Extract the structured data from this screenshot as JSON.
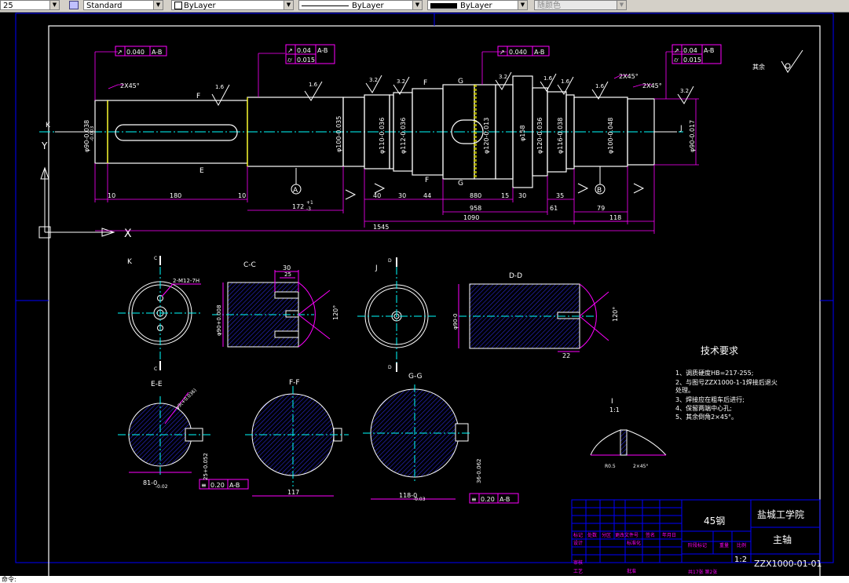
{
  "toolbar": {
    "scale_value": "25",
    "dimstyle_value": "Standard",
    "layer_value": "ByLayer",
    "linetype_value": "ByLayer",
    "lineweight_value": "ByLayer",
    "plotstyle_value": "随颜色"
  },
  "colors": {
    "background": "#000000",
    "border": "#0000ff",
    "dimension": "#ff00ff",
    "geometry": "#ffffff",
    "centerline": "#00ffff",
    "hatch": "#2020c0",
    "text": "#ffffff",
    "yellow": "#ffff00"
  },
  "drawing": {
    "view_labels": {
      "k": "K",
      "j": "J",
      "cc": "C-C",
      "dd": "D-D",
      "ee": "E-E",
      "ff": "F-F",
      "gg": "G-G",
      "detail": "I",
      "detail_scale": "1:1",
      "section_f": "F",
      "section_g": "G",
      "section_e": "E",
      "datum_a": "A",
      "datum_b": "B",
      "c_mark": "C",
      "d_mark": "D"
    },
    "tolerance_frames": [
      {
        "sym": "↗",
        "value": "0.040",
        "datum": "A-B"
      },
      {
        "sym": "↗",
        "value": "0.04",
        "datum": "A-B"
      },
      {
        "sym": "⌭",
        "value": "0.015",
        "datum": ""
      },
      {
        "sym": "↗",
        "value": "0.040",
        "datum": "A-B"
      },
      {
        "sym": "↗",
        "value": "0.04",
        "datum": "A-B"
      },
      {
        "sym": "⌭",
        "value": "0.015",
        "datum": ""
      },
      {
        "sym": "≡",
        "value": "0.20",
        "datum": "A-B"
      },
      {
        "sym": "≡",
        "value": "0.20",
        "datum": "A-B"
      }
    ],
    "dims": {
      "d10a": "10",
      "d180": "180",
      "d10b": "10",
      "d172": "172",
      "d172tol": "+1",
      "d172tol2": "-3",
      "d40": "40",
      "d30a": "30",
      "d44": "44",
      "d880": "880",
      "d15": "15",
      "d30b": "30",
      "d35": "35",
      "d958": "958",
      "d61": "61",
      "d79": "79",
      "d1090": "1090",
      "d118": "118",
      "d1545": "1545",
      "chamfer1": "2X45°",
      "chamfer2": "2X45°",
      "chamfer3": "2X45°",
      "phi90a": "φ90-0.038",
      "phi90b": "-0.003",
      "phi100": "φ100-0.035",
      "phi110": "φ110-0.036",
      "phi112": "φ112-0.036",
      "phi120a": "φ120-0.013",
      "phi158": "φ158",
      "phi120b": "φ120-0.036",
      "phi116": "φ116-0.038",
      "phi100b": "φ100-0.048",
      "phi90c": "φ90-0.017",
      "cc30": "30",
      "cc25": "25",
      "ccphi90": "φ90+0.008",
      "dd22": "22",
      "ddphi90": "φ90-0",
      "thread": "2-M12-7H",
      "ee81": "81-0",
      "ee81b": "-0.02",
      "ee05": "25+0.052",
      "ff117": "117",
      "gg118": "118-0",
      "gg118b": "-0.03",
      "gg36": "36-0.062",
      "ang120a": "120°",
      "ang120b": "120°",
      "ee_phi": "φ9(+0.036)",
      "roughness1": "1.6",
      "roughness2": "1.6",
      "roughness3": "3.2",
      "roughness4": "3.2",
      "roughness5": "3.2",
      "roughness6": "1.6",
      "roughness7": "1.6",
      "roughness8": "1.6",
      "roughness9": "3.2",
      "detail_r": "R0.5",
      "detail_c": "2×45°",
      "rest": "其余"
    },
    "tech_title": "技术要求",
    "tech_lines": [
      "1、调质硬度HB=217-255;",
      "2、与图号ZZX1000-1-1焊接后退火",
      "处理。",
      "3、焊接应在粗车后进行;",
      "4、保留两端中心孔;",
      "5、其余倒角2×45°。"
    ]
  },
  "title_block": {
    "material": "45钢",
    "school": "盐城工学院",
    "part_name": "主轴",
    "drawing_no": "ZZX1000-01-01",
    "scale": "1:2",
    "sheets": "共17张 第2张",
    "headers": [
      "标记",
      "处数",
      "分区",
      "更改文件号",
      "签名",
      "年月日"
    ],
    "row_labels": [
      "设计",
      "标准化",
      "审核",
      "工艺",
      "批准"
    ],
    "stage_labels": [
      "阶段标记",
      "重量",
      "比例"
    ]
  },
  "cmd_text": "命令:"
}
